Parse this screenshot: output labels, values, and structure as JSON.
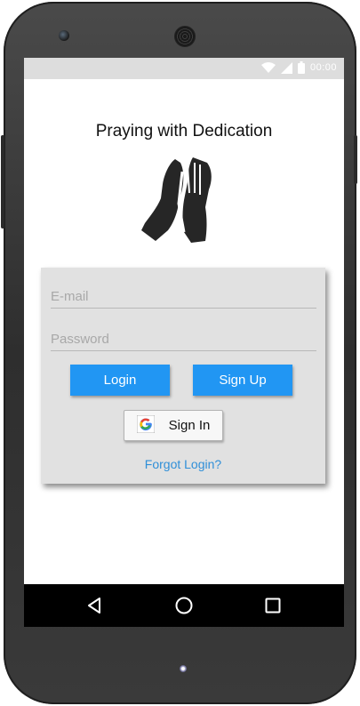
{
  "app": {
    "title": "Praying with Dedication"
  },
  "statusbar": {
    "time_text": "00:00",
    "icons": [
      "wifi-icon",
      "cell-signal-icon",
      "battery-icon"
    ]
  },
  "login_card": {
    "email_placeholder": "E-mail",
    "email_value": "",
    "password_placeholder": "Password",
    "password_value": "",
    "login_label": "Login",
    "signup_label": "Sign Up",
    "google_signin_label": "Sign In",
    "forgot_label": "Forgot Login?"
  },
  "navbar": {
    "items": [
      "back-icon",
      "home-icon",
      "recents-icon"
    ]
  },
  "colors": {
    "accent": "#2196f3",
    "link": "#2f8fd8",
    "card": "#e1e1e1",
    "statusbar": "#dddddd",
    "navbar": "#000000"
  }
}
